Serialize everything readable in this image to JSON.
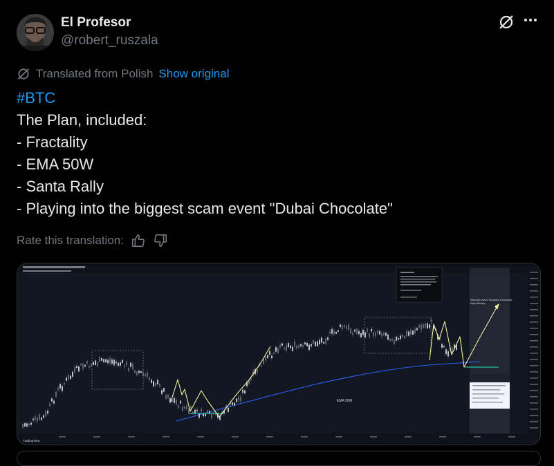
{
  "author": {
    "name": "El Profesor",
    "handle": "@robert_ruszala"
  },
  "icons": {
    "grok": "grok-slash-icon",
    "more": "more-dots-icon",
    "translate": "grok-translate-icon",
    "thumbs_up": "thumbs-up-icon",
    "thumbs_down": "thumbs-down-icon"
  },
  "translation": {
    "label": "Translated from Polish",
    "show_original": "Show original",
    "rate_label": "Rate this translation:"
  },
  "tweet": {
    "hashtag": "#BTC",
    "lines": [
      "The Plan, included:",
      "- Fractality",
      "- EMA 50W",
      "- Santa Rally",
      "- Playing into the biggest scam event \"Dubai Chocolate\""
    ]
  },
  "chart": {
    "ema_label": "EMA 50W",
    "annotation": "Wirtualny zwrot \"Dubajska Czekolada\"\nRajd Mikołaja",
    "watermark": "TradingView",
    "colors": {
      "background": "#131722",
      "candles": "#d1d4dc",
      "projection": "#f5f0a0",
      "ema": "#2962ff",
      "support": "#26a69a"
    }
  }
}
